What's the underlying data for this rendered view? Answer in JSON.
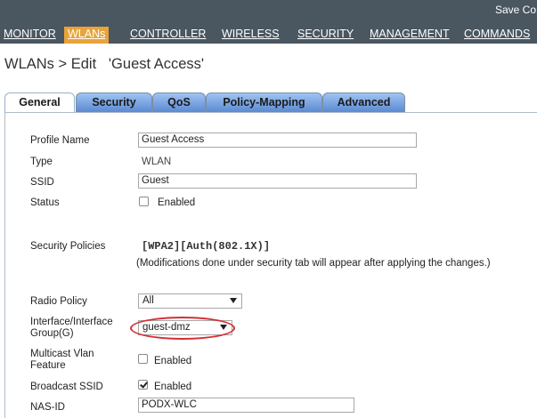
{
  "header": {
    "save_config": "Save Co",
    "nav": [
      {
        "label": "MONITOR"
      },
      {
        "label": "WLANs"
      },
      {
        "label": "CONTROLLER"
      },
      {
        "label": "WIRELESS"
      },
      {
        "label": "SECURITY"
      },
      {
        "label": "MANAGEMENT"
      },
      {
        "label": "COMMANDS"
      }
    ],
    "active_nav": "WLANs",
    "bar_color": "#4a5660",
    "active_color": "#e8a33b"
  },
  "page": {
    "title": "WLANs > Edit   'Guest Access'"
  },
  "tabs": [
    {
      "label": "General",
      "active": true
    },
    {
      "label": "Security",
      "active": false
    },
    {
      "label": "QoS",
      "active": false
    },
    {
      "label": "Policy-Mapping",
      "active": false
    },
    {
      "label": "Advanced",
      "active": false
    }
  ],
  "form": {
    "profile_name": {
      "label": "Profile Name",
      "value": "Guest Access"
    },
    "type": {
      "label": "Type",
      "value": "WLAN"
    },
    "ssid": {
      "label": "SSID",
      "value": "Guest"
    },
    "status": {
      "label": "Status",
      "checkbox_label": "Enabled",
      "checked": false
    },
    "security_policies": {
      "label": "Security Policies",
      "value": "[WPA2][Auth(802.1X)]",
      "note": "(Modifications done under security tab will appear after applying the changes.)"
    },
    "radio_policy": {
      "label": "Radio Policy",
      "value": "All"
    },
    "interface_group": {
      "label_line1": "Interface/Interface",
      "label_line2": "Group(G)",
      "value": "guest-dmz"
    },
    "multicast_vlan": {
      "label_line1": "Multicast Vlan",
      "label_line2": "Feature",
      "checkbox_label": "Enabled",
      "checked": false
    },
    "broadcast_ssid": {
      "label": "Broadcast SSID",
      "checkbox_label": "Enabled",
      "checked": true
    },
    "nas_id": {
      "label": "NAS-ID",
      "value": "PODX-WLC"
    }
  },
  "annotation": {
    "highlight_color": "#d42f36"
  }
}
